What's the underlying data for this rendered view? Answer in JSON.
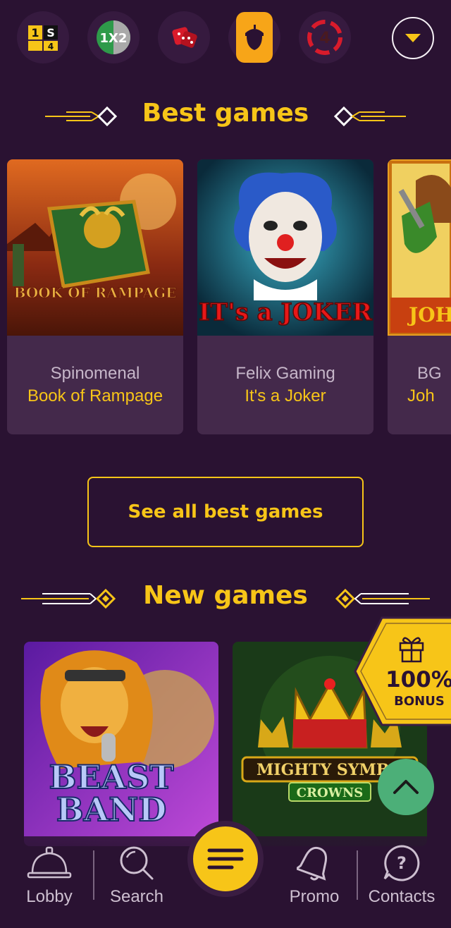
{
  "categories": [
    {
      "name": "sports-1s4",
      "glyph": "1S4"
    },
    {
      "name": "1x2",
      "glyph": "1X2"
    },
    {
      "name": "dice",
      "glyph": "⚄"
    },
    {
      "name": "acorn",
      "glyph": "🌰"
    },
    {
      "name": "live-4",
      "glyph": "4"
    }
  ],
  "best_games": {
    "title": "Best games",
    "cards": [
      {
        "provider": "Spinomenal",
        "name": "Book of Rampage",
        "art_text": "BOOK OF RAMPAGE"
      },
      {
        "provider": "Felix Gaming",
        "name": "It's a Joker",
        "art_text": "IT's a JOKER"
      },
      {
        "provider": "BG",
        "name": "Joh",
        "art_text": "JOHN"
      }
    ],
    "see_all": "See all best games"
  },
  "new_games": {
    "title": "New games",
    "cards": [
      {
        "art_text_1": "BEAST",
        "art_text_2": "BAND"
      },
      {
        "art_text_1": "MIGHTY SYMBO",
        "art_text_2": "CROWNS"
      }
    ]
  },
  "bonus": {
    "percent": "100%",
    "label": "BONUS"
  },
  "nav": {
    "lobby": "Lobby",
    "search": "Search",
    "promo": "Promo",
    "contacts": "Contacts"
  },
  "colors": {
    "accent": "#f7c518",
    "background": "#2a1232",
    "card": "#44294b",
    "scroll_top": "#4caf78"
  }
}
